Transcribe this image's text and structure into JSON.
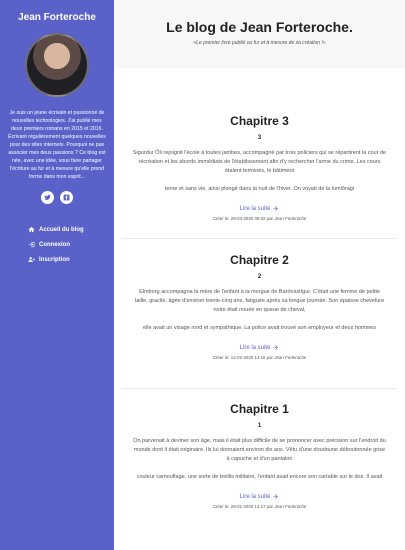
{
  "sidebar": {
    "brand": "Jean Forteroche",
    "bio": "Je suis un jeune écrivain et passionné de nouvelles technologies. J'ai publié mes deux premiers romans en 2015 et 2016. Écrivant régulièrement quelques nouvelles pour des sites internets. Pourquoi ne pas associer mes deux passions ? Ce blog est née, avec une idée, vous faire partager l'écriture au fur et à mesure qu'elle prend forme dans mon esprit...",
    "nav": [
      {
        "label": "Accueil du blog",
        "icon": "home-icon"
      },
      {
        "label": "Connexion",
        "icon": "sign-in-icon"
      },
      {
        "label": "Inscription",
        "icon": "user-plus-icon"
      }
    ]
  },
  "header": {
    "title": "Le blog de Jean Forteroche.",
    "tagline": "«Le premier livre publié ou fur et à mesure de sa création !»"
  },
  "posts": [
    {
      "title": "Chapitre 3",
      "number": "3",
      "excerpt": "Sigurdur Óli rejoignit l'école à toutes jambes, accompagné par trois policiers qui se répartirent la cour de récréation et les abords immédiats de l'établissement afin d'y rechercher l'arme du crime. Les cours étaient terminés, le bâtiment",
      "extra": "terne et sans vie, ainsi plongé dans la nuit de l'hiver. On voyait de la lumiðragi",
      "read_more": "Lire la suite",
      "meta_prefix": "Créer le: 29-03-2020 09:02 par",
      "author": "Jean Forteroche"
    },
    {
      "title": "Chapitre 2",
      "number": "2",
      "excerpt": "Elmborg accompagna la mère de l'enfant à la morgue de Barónsstígur. C'était une femme de petite taille, gracile, âgée d'environ trente-cinq ans, fatiguée après sa longue journée. Son épaisse chevelure noire était nouée en queue de cheval,",
      "extra": "elle avait un visage rond et sympathique. La police avait trouvé son employeur et deux hommes",
      "read_more": "Lire la suite",
      "meta_prefix": "Créer le: 12-02-2020 14:19 par",
      "author": "Jean Forteroche"
    },
    {
      "title": "Chapitre 1",
      "number": "1",
      "excerpt": "On parvenait à deviner son âge, mais il était plus difficile de se prononcer avec précision sur l'endroit du monde dont il était originaire. Ils lui donnaient environ dix ans. Vêtu d'une doudoune déboutonnée grise à capuche et d'un pantalon",
      "extra": "couleur camouflage, une sorte de treillis militaire, l'enfant avait encore son cartable sur le dos. Il avait",
      "read_more": "Lire la suite",
      "meta_prefix": "Créer le: 29-01-2020 14:17 par",
      "author": "Jean Forteroche"
    }
  ],
  "colors": {
    "sidebar": "#5a61c9",
    "link": "#5a61c9"
  }
}
